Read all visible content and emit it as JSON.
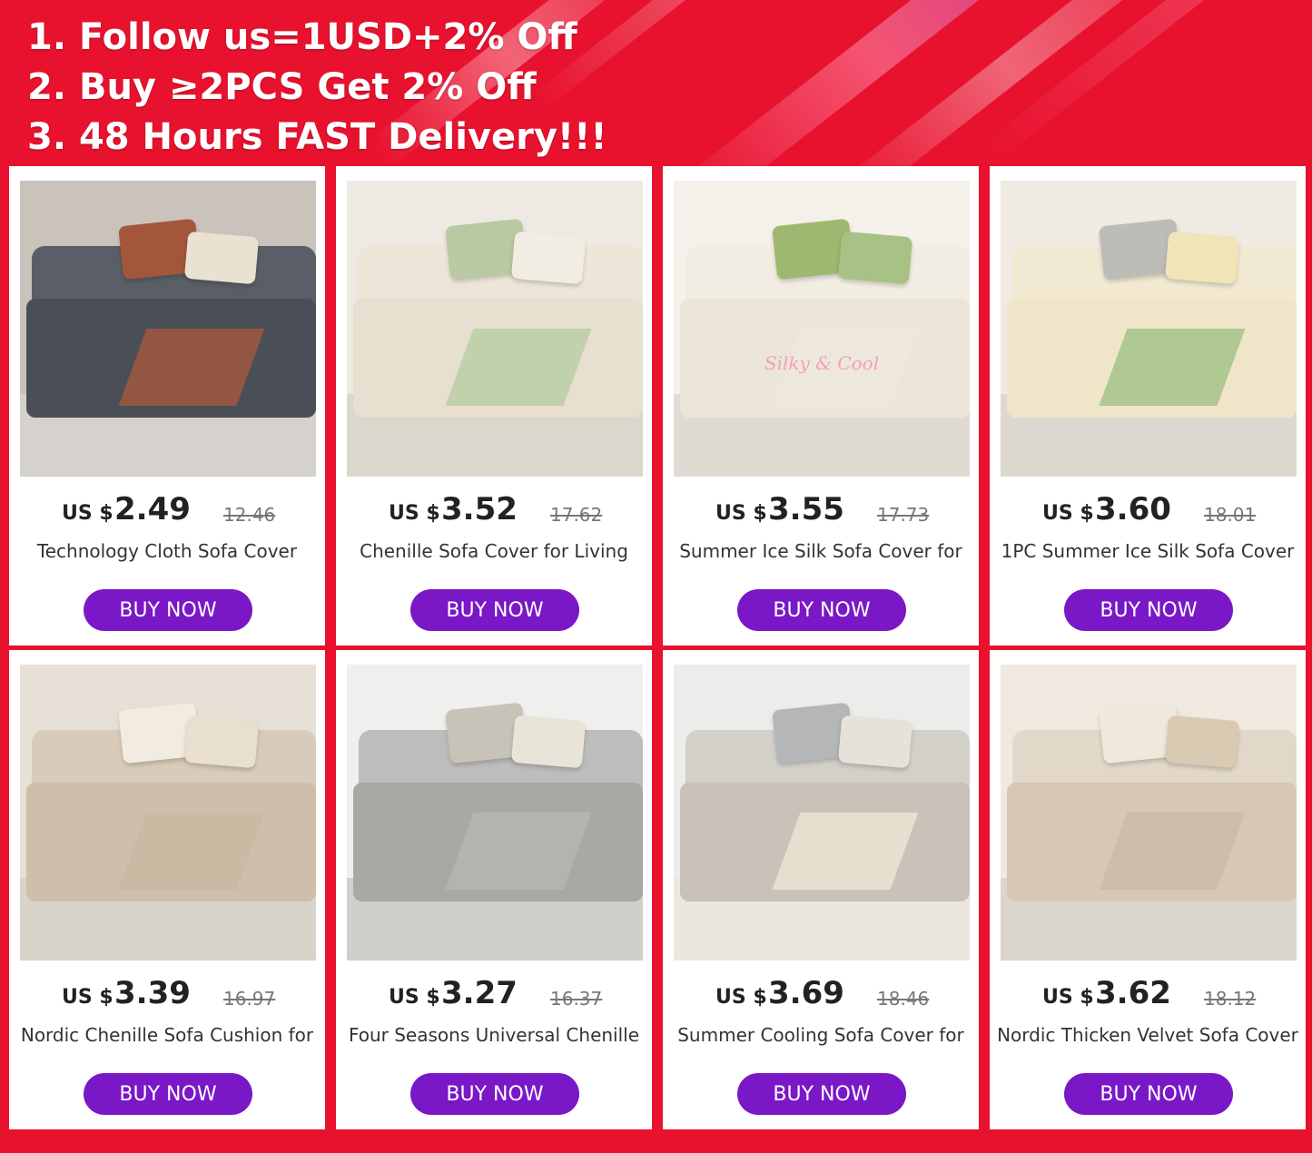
{
  "promo_lines": [
    "1. Follow us=1USD+2% Off",
    "2. Buy ≥2PCS Get 2% Off",
    "3. 48 Hours FAST Delivery!!!"
  ],
  "currency_label": "US $",
  "buy_label": "BUY NOW",
  "products": [
    {
      "price": "2.49",
      "original": "12.46",
      "title": "Technology Cloth Sofa Cover",
      "wall": "#c9c3bc",
      "sofa": "#5a5e66",
      "seat": "#4a4f57",
      "pillow1": "#a4563a",
      "pillow2": "#e9e1d2",
      "throw": "#9a5640",
      "floor": "#d5d2ce"
    },
    {
      "price": "3.52",
      "original": "17.62",
      "title": "Chenille Sofa Cover for Living",
      "wall": "#eeeae3",
      "sofa": "#ede6d8",
      "seat": "#e7dfcf",
      "pillow1": "#b9c9a2",
      "pillow2": "#f2ede2",
      "throw": "#bccfa7",
      "floor": "#dcd7cd"
    },
    {
      "price": "3.55",
      "original": "17.73",
      "title": "Summer Ice Silk Sofa Cover for",
      "wall": "#f4f1ea",
      "sofa": "#f2ede3",
      "seat": "#ece6d9",
      "pillow1": "#9fb86f",
      "pillow2": "#a8c184",
      "throw": "#eee8dc",
      "floor": "#e0dbd2",
      "caption": "Silky & Cool"
    },
    {
      "price": "3.60",
      "original": "18.01",
      "title": "1PC Summer Ice Silk Sofa Cover",
      "wall": "#f0ebe2",
      "sofa": "#f1e9d2",
      "seat": "#efe6c9",
      "pillow1": "#bdbdb8",
      "pillow2": "#f1e4b6",
      "throw": "#a8c48b",
      "floor": "#ddd8cf"
    },
    {
      "price": "3.39",
      "original": "16.97",
      "title": "Nordic Chenille Sofa Cushion for",
      "wall": "#e6e0d6",
      "sofa": "#d8cbb9",
      "seat": "#cdbfab",
      "pillow1": "#f2ece0",
      "pillow2": "#e8dfcf",
      "throw": "#c9b9a3",
      "floor": "#d9d4cb"
    },
    {
      "price": "3.27",
      "original": "16.37",
      "title": "Four Seasons Universal Chenille",
      "wall": "#efefed",
      "sofa": "#bdbdbb",
      "seat": "#a9a8a5",
      "pillow1": "#c7c3b8",
      "pillow2": "#e9e4d8",
      "throw": "#b5b4b0",
      "floor": "#d1cfca"
    },
    {
      "price": "3.69",
      "original": "18.46",
      "title": "Summer Cooling Sofa Cover for",
      "wall": "#ececea",
      "sofa": "#d3cfc9",
      "seat": "#c8c2b9",
      "pillow1": "#b4b6b8",
      "pillow2": "#e6e2da",
      "throw": "#e9e2d3",
      "floor": "#ebe7df"
    },
    {
      "price": "3.62",
      "original": "18.12",
      "title": "Nordic Thicken Velvet Sofa Cover",
      "wall": "#efe9df",
      "sofa": "#e2d8c9",
      "seat": "#d6c8b3",
      "pillow1": "#efe9dc",
      "pillow2": "#d9cab3",
      "throw": "#cbbda7",
      "floor": "#dad6cf"
    }
  ]
}
